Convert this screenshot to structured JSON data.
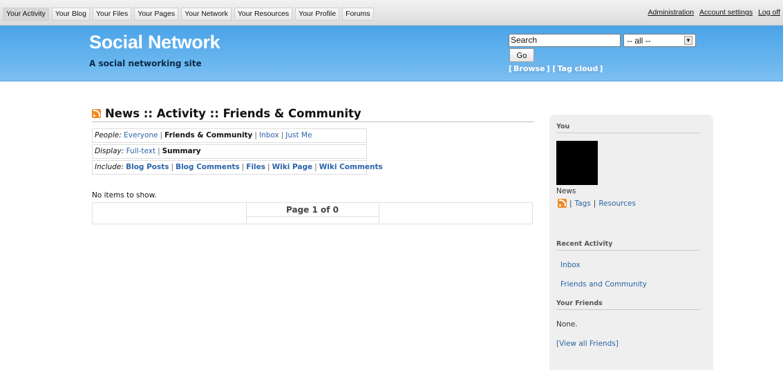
{
  "topbar": {
    "tabs": [
      "Your Activity",
      "Your Blog",
      "Your Files",
      "Your Pages",
      "Your Network",
      "Your Resources",
      "Your Profile",
      "Forums"
    ],
    "right_links": [
      "Administration",
      "Account settings",
      "Log off"
    ]
  },
  "header": {
    "title": "Social Network",
    "subtitle": "A social networking site",
    "search_value": "Search",
    "select_value": "-- all --",
    "go_label": "Go",
    "browse_label": "Browse",
    "tagcloud_label": "Tag cloud"
  },
  "main": {
    "heading": "News :: Activity :: Friends & Community",
    "people": {
      "label": "People:",
      "options": [
        "Everyone",
        "Friends & Community",
        "Inbox",
        "Just Me"
      ]
    },
    "display": {
      "label": "Display:",
      "options": [
        "Full-text",
        "Summary"
      ]
    },
    "include": {
      "label": "Include:",
      "options": [
        "Blog Posts",
        "Blog Comments",
        "Files",
        "Wiki Page",
        "Wiki Comments"
      ]
    },
    "no_items": "No items to show.",
    "page_info": "Page 1 of 0"
  },
  "sidebar": {
    "you_heading": "You",
    "news_label": "News",
    "tags_link": "Tags",
    "resources_link": "Resources",
    "recent_heading": "Recent Activity",
    "inbox_link": "Inbox",
    "friends_community_link": "Friends and Community",
    "friends_heading": "Your Friends",
    "none_text": "None.",
    "view_all_link": "[View all Friends]"
  }
}
